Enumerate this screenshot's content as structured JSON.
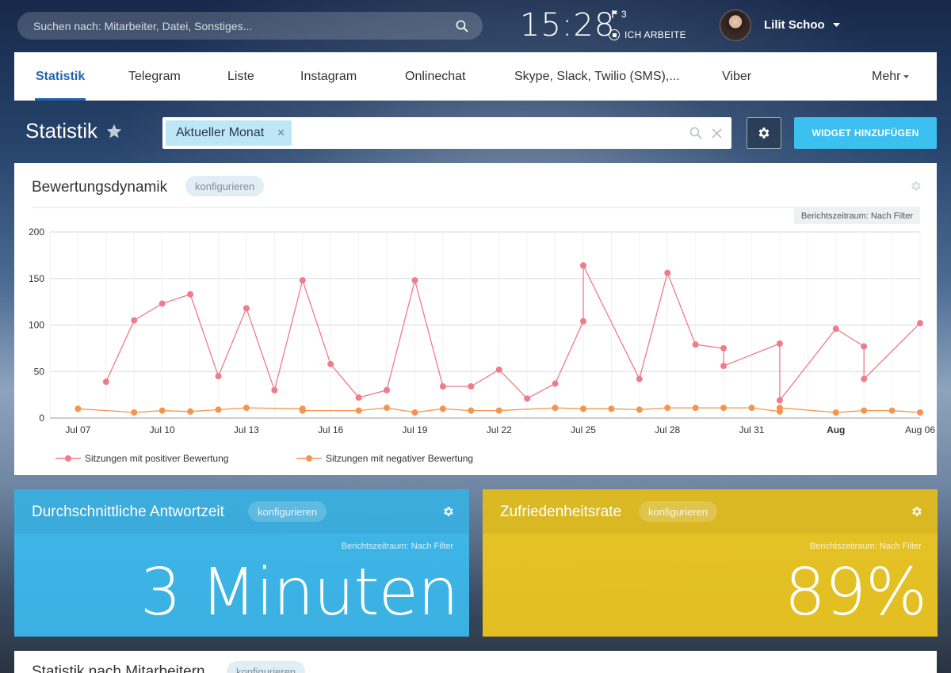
{
  "header": {
    "search_placeholder": "Suchen nach: Mitarbeiter, Datei, Sonstiges...",
    "clock": "15:28",
    "flag_count": "3",
    "work_status": "ICH ARBEITE",
    "user_name": "Lilit Schoo"
  },
  "tabs": [
    {
      "label": "Statistik"
    },
    {
      "label": "Telegram"
    },
    {
      "label": "Liste"
    },
    {
      "label": "Instagram"
    },
    {
      "label": "Onlinechat"
    },
    {
      "label": "Skype, Slack, Twilio (SMS),..."
    },
    {
      "label": "Viber"
    },
    {
      "label": "Mehr"
    }
  ],
  "toolbar": {
    "title": "Statistik",
    "filter_chip": "Aktueller Monat",
    "add_widget_label": "WIDGET HINZUFÜGEN"
  },
  "chart_widget": {
    "title": "Bewertungsdynamik",
    "config_label": "konfigurieren",
    "period_label": "Berichtszeitraum: Nach Filter"
  },
  "chart_data": {
    "type": "line",
    "title": "",
    "xlabel": "",
    "ylabel": "",
    "ylim": [
      0,
      200
    ],
    "y_ticks": [
      0,
      50,
      100,
      150,
      200
    ],
    "x_range": [
      "2023-07-06",
      "2023-08-06"
    ],
    "x_ticks": [
      {
        "date": "2023-07-07",
        "label": "Jul 07",
        "bold": false
      },
      {
        "date": "2023-07-10",
        "label": "Jul 10",
        "bold": false
      },
      {
        "date": "2023-07-13",
        "label": "Jul 13",
        "bold": false
      },
      {
        "date": "2023-07-16",
        "label": "Jul 16",
        "bold": false
      },
      {
        "date": "2023-07-19",
        "label": "Jul 19",
        "bold": false
      },
      {
        "date": "2023-07-22",
        "label": "Jul 22",
        "bold": false
      },
      {
        "date": "2023-07-25",
        "label": "Jul 25",
        "bold": false
      },
      {
        "date": "2023-07-28",
        "label": "Jul 28",
        "bold": false
      },
      {
        "date": "2023-07-31",
        "label": "Jul 31",
        "bold": false
      },
      {
        "date": "2023-08-03",
        "label": "Aug",
        "bold": true
      },
      {
        "date": "2023-08-06",
        "label": "Aug 06",
        "bold": false
      }
    ],
    "grid": true,
    "legend_position": "bottom-left",
    "series": [
      {
        "name": "Sitzungen mit positiver Bewertung",
        "color": "#f07b8a",
        "points": [
          [
            "2023-07-08",
            39
          ],
          [
            "2023-07-09",
            105
          ],
          [
            "2023-07-10",
            123
          ],
          [
            "2023-07-11",
            133
          ],
          [
            "2023-07-12",
            45
          ],
          [
            "2023-07-13",
            118
          ],
          [
            "2023-07-14",
            30
          ],
          [
            "2023-07-15",
            148
          ],
          [
            "2023-07-16",
            58
          ],
          [
            "2023-07-17",
            22
          ],
          [
            "2023-07-18",
            30
          ],
          [
            "2023-07-19",
            148
          ],
          [
            "2023-07-20",
            34
          ],
          [
            "2023-07-21",
            34
          ],
          [
            "2023-07-22",
            52
          ],
          [
            "2023-07-23",
            21
          ],
          [
            "2023-07-24",
            37
          ],
          [
            "2023-07-25",
            104
          ],
          [
            "2023-07-25",
            164
          ],
          [
            "2023-07-27",
            42
          ],
          [
            "2023-07-28",
            156
          ],
          [
            "2023-07-29",
            79
          ],
          [
            "2023-07-30",
            75
          ],
          [
            "2023-07-30",
            56
          ],
          [
            "2023-08-01",
            80
          ],
          [
            "2023-08-01",
            19
          ],
          [
            "2023-08-03",
            96
          ],
          [
            "2023-08-04",
            77
          ],
          [
            "2023-08-04",
            42
          ],
          [
            "2023-08-06",
            102
          ]
        ]
      },
      {
        "name": "Sitzungen mit negativer Bewertung",
        "color": "#f5944e",
        "points": [
          [
            "2023-07-07",
            10
          ],
          [
            "2023-07-09",
            6
          ],
          [
            "2023-07-10",
            8
          ],
          [
            "2023-07-11",
            7
          ],
          [
            "2023-07-12",
            9
          ],
          [
            "2023-07-13",
            11
          ],
          [
            "2023-07-15",
            10
          ],
          [
            "2023-07-15",
            8
          ],
          [
            "2023-07-17",
            8
          ],
          [
            "2023-07-18",
            11
          ],
          [
            "2023-07-19",
            6
          ],
          [
            "2023-07-20",
            10
          ],
          [
            "2023-07-21",
            8
          ],
          [
            "2023-07-22",
            8
          ],
          [
            "2023-07-24",
            11
          ],
          [
            "2023-07-25",
            10
          ],
          [
            "2023-07-26",
            10
          ],
          [
            "2023-07-27",
            9
          ],
          [
            "2023-07-28",
            11
          ],
          [
            "2023-07-29",
            11
          ],
          [
            "2023-07-30",
            11
          ],
          [
            "2023-07-31",
            11
          ],
          [
            "2023-08-01",
            7
          ],
          [
            "2023-08-01",
            11
          ],
          [
            "2023-08-03",
            6
          ],
          [
            "2023-08-04",
            8
          ],
          [
            "2023-08-05",
            8
          ],
          [
            "2023-08-06",
            6
          ]
        ]
      }
    ]
  },
  "stat_widgets": [
    {
      "title": "Durchschnittliche Antwortzeit",
      "config_label": "konfigurieren",
      "period_label": "Berichtszeitraum: Nach Filter",
      "value": "3 Minuten",
      "color": "#3cbaee"
    },
    {
      "title": "Zufriedenheitsrate",
      "config_label": "konfigurieren",
      "period_label": "Berichtszeitraum: Nach Filter",
      "value": "89%",
      "color": "#f0c81e"
    }
  ],
  "bottom_widget": {
    "title": "Statistik nach Mitarbeitern",
    "config_label": "konfigurieren"
  }
}
